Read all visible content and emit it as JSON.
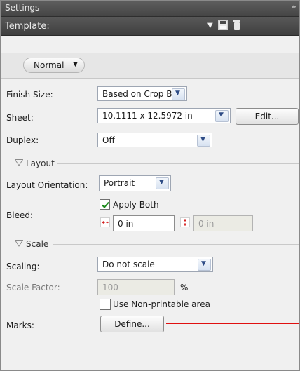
{
  "panel": {
    "title": "Settings"
  },
  "template": {
    "label": "Template:"
  },
  "mode": {
    "label": "Normal"
  },
  "fields": {
    "finish_size": {
      "label": "Finish Size:",
      "value": "Based on Crop Box"
    },
    "sheet": {
      "label": "Sheet:",
      "value": "10.1111 x 12.5972 in",
      "edit_label": "Edit..."
    },
    "duplex": {
      "label": "Duplex:",
      "value": "Off"
    }
  },
  "layout_section": {
    "title": "Layout",
    "orientation_label": "Layout Orientation:",
    "orientation_value": "Portrait",
    "bleed_label": "Bleed:",
    "apply_both_label": "Apply Both",
    "apply_both_checked": true,
    "bleed_horizontal": "0 in",
    "bleed_vertical": "0 in"
  },
  "scale_section": {
    "title": "Scale",
    "scaling_label": "Scaling:",
    "scaling_value": "Do not scale",
    "factor_label": "Scale Factor:",
    "factor_value": "100",
    "factor_unit": "%",
    "nonprintable_label": "Use Non-printable area",
    "nonprintable_checked": false,
    "marks_label": "Marks:",
    "define_label": "Define..."
  },
  "icons": {
    "panel_grip": "double-chevron-right-icon",
    "template_dropdown": "triangle-down-icon",
    "save": "floppy-disk-icon",
    "delete": "trash-icon",
    "bleed_h": "horizontal-bleed-icon",
    "bleed_v": "vertical-bleed-icon"
  },
  "colors": {
    "accent_annotation": "#e01010",
    "title_bar": "#4f4f4f",
    "checkmark": "#1c8a1c"
  }
}
